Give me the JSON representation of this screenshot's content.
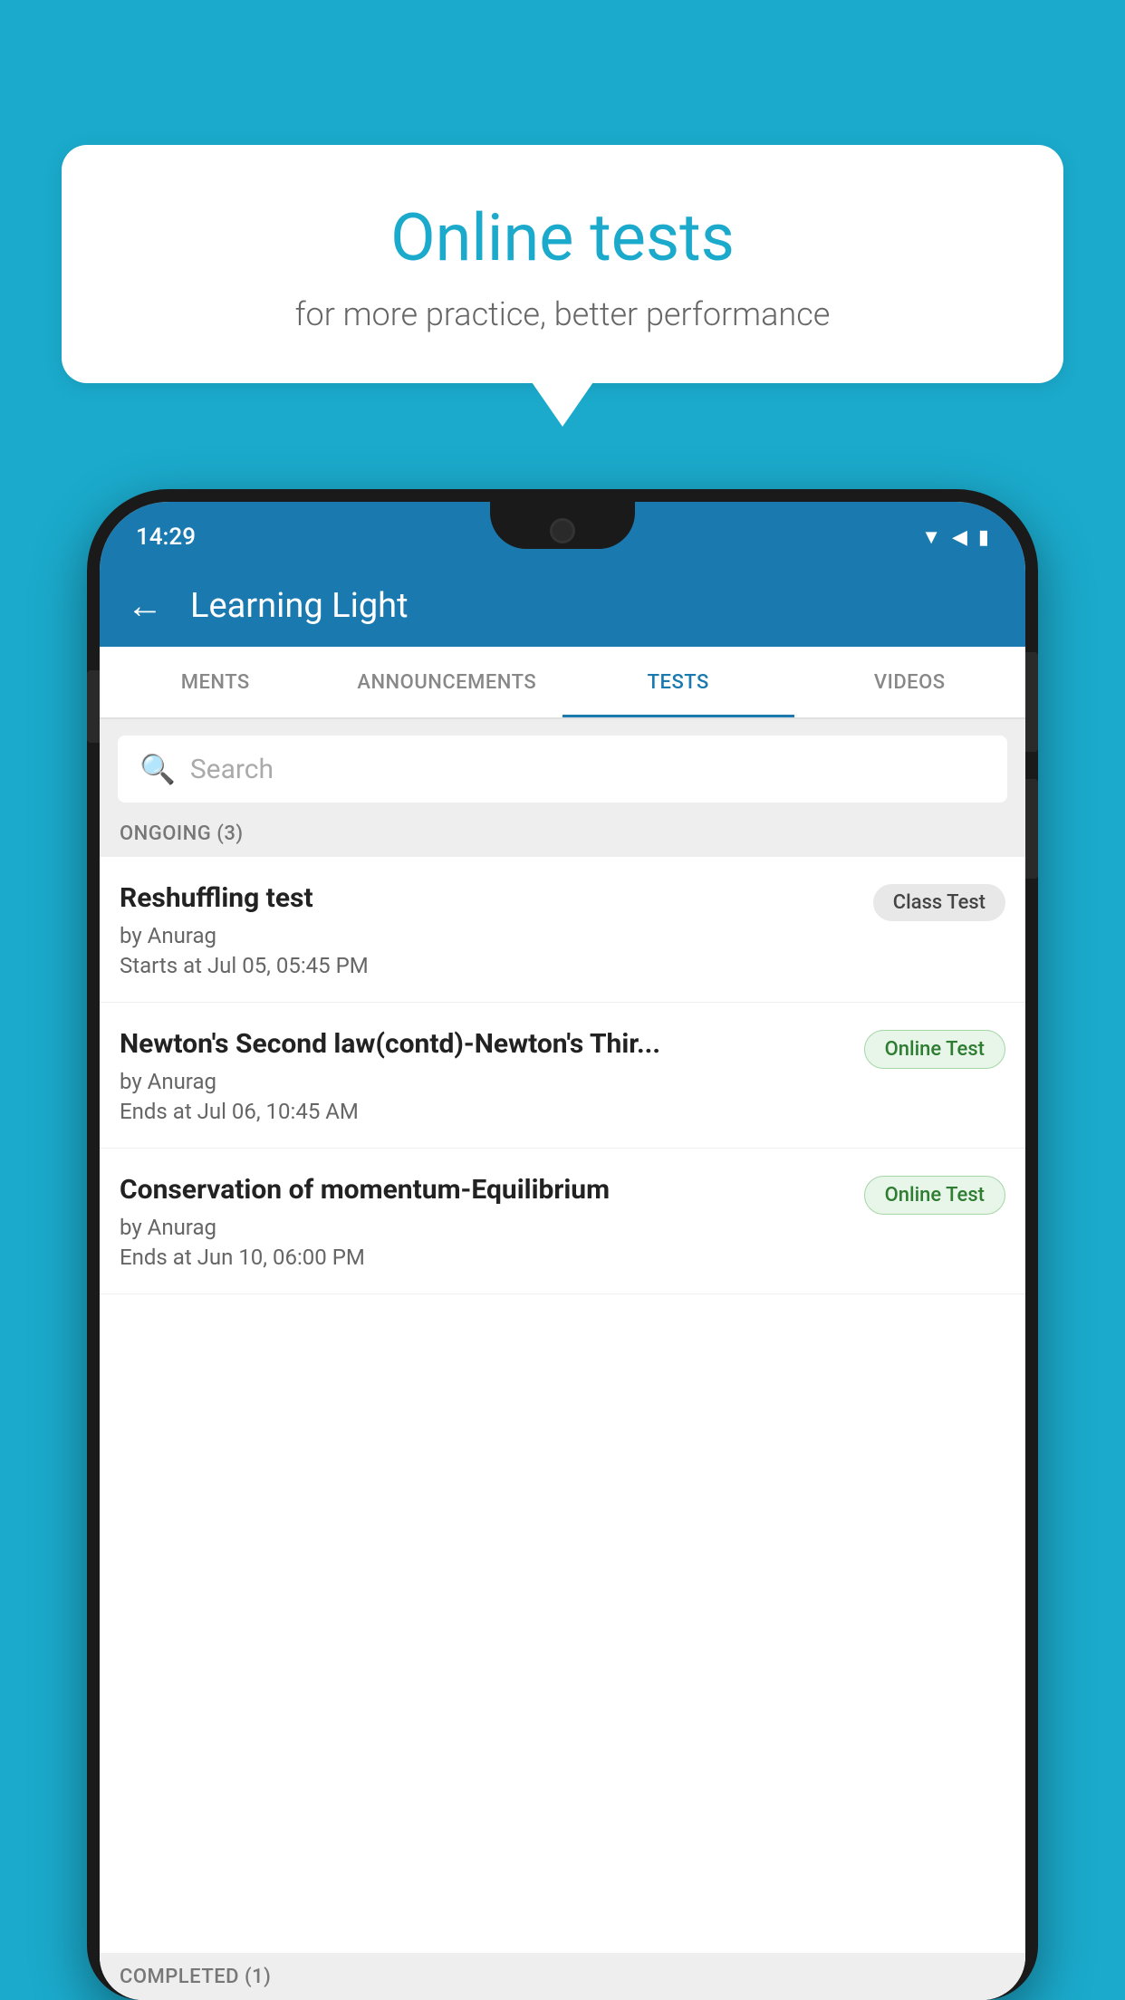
{
  "background_color": "#1BAACC",
  "speech_bubble": {
    "title": "Online tests",
    "subtitle": "for more practice, better performance"
  },
  "status_bar": {
    "time": "14:29",
    "icons": [
      "▲",
      "◀",
      "▮"
    ]
  },
  "app_header": {
    "back_label": "←",
    "title": "Learning Light"
  },
  "tabs": [
    {
      "label": "MENTS",
      "active": false
    },
    {
      "label": "ANNOUNCEMENTS",
      "active": false
    },
    {
      "label": "TESTS",
      "active": true
    },
    {
      "label": "VIDEOS",
      "active": false
    }
  ],
  "search": {
    "placeholder": "Search"
  },
  "ongoing_section": {
    "label": "ONGOING (3)"
  },
  "test_items": [
    {
      "name": "Reshuffling test",
      "author": "by Anurag",
      "time_label": "Starts at",
      "time": "Jul 05, 05:45 PM",
      "badge": "Class Test",
      "badge_type": "class"
    },
    {
      "name": "Newton's Second law(contd)-Newton's Thir...",
      "author": "by Anurag",
      "time_label": "Ends at",
      "time": "Jul 06, 10:45 AM",
      "badge": "Online Test",
      "badge_type": "online"
    },
    {
      "name": "Conservation of momentum-Equilibrium",
      "author": "by Anurag",
      "time_label": "Ends at",
      "time": "Jun 10, 06:00 PM",
      "badge": "Online Test",
      "badge_type": "online"
    }
  ],
  "completed_section": {
    "label": "COMPLETED (1)"
  }
}
